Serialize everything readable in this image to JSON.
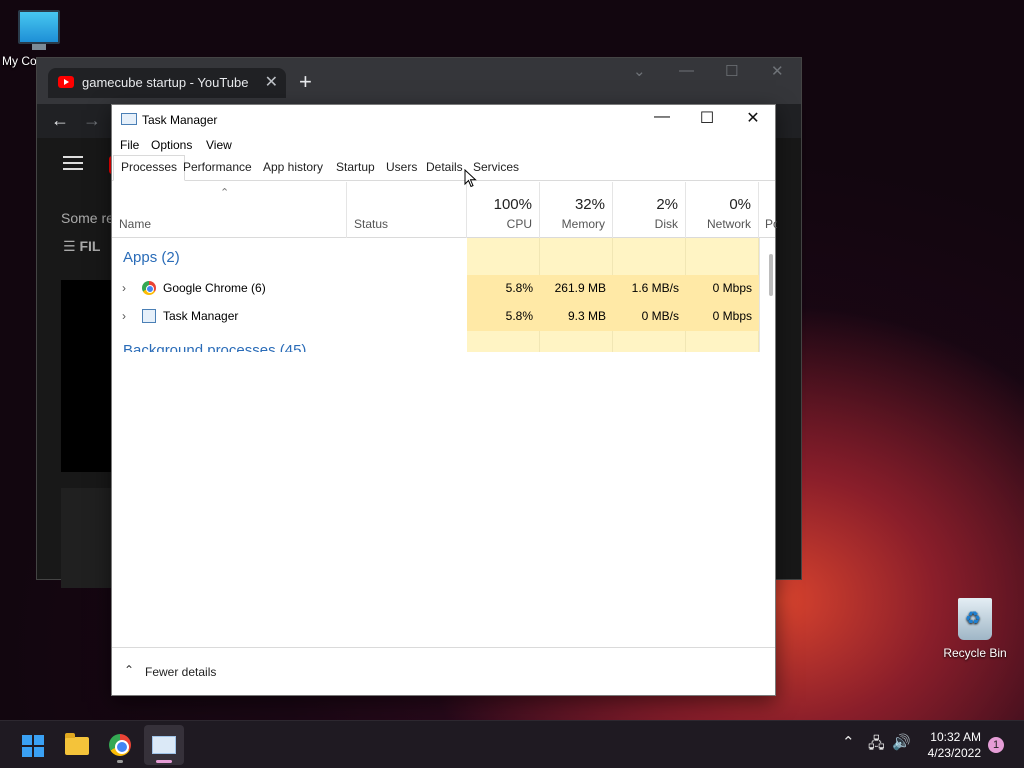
{
  "desktop": {
    "icons": [
      {
        "label": "My Co",
        "icon": "monitor-icon"
      },
      {
        "label": "Recycle Bin",
        "icon": "recycle-bin-icon"
      }
    ]
  },
  "chrome": {
    "tab_title": "gamecube startup - YouTube",
    "tab_close": "✕",
    "new_tab": "+",
    "back": "←",
    "forward": "→",
    "page_text_some": "Some re",
    "page_text_filters": "FIL",
    "win_controls": {
      "minimize": "—",
      "maximize": "☐",
      "close": "✕",
      "dropdown": "⌄"
    }
  },
  "task_manager": {
    "title": "Task Manager",
    "controls": {
      "minimize": "—",
      "maximize": "☐",
      "close": "✕"
    },
    "menu": [
      "File",
      "Options",
      "View"
    ],
    "tabs": [
      "Processes",
      "Performance",
      "App history",
      "Startup",
      "Users",
      "Details",
      "Services"
    ],
    "active_tab": "Processes",
    "columns": {
      "name": "Name",
      "status": "Status",
      "cpu": {
        "pct": "100%",
        "label": "CPU"
      },
      "memory": {
        "pct": "32%",
        "label": "Memory"
      },
      "disk": {
        "pct": "2%",
        "label": "Disk"
      },
      "network": {
        "pct": "0%",
        "label": "Network"
      },
      "power": "Po"
    },
    "sort_caret": "⌃",
    "groups": {
      "apps": "Apps (2)",
      "background": "Background processes (45)"
    },
    "rows": [
      {
        "name": "Google Chrome (6)",
        "cpu": "5.8%",
        "memory": "261.9 MB",
        "disk": "1.6 MB/s",
        "network": "0 Mbps",
        "icon": "chrome-icon"
      },
      {
        "name": "Task Manager",
        "cpu": "5.8%",
        "memory": "9.3 MB",
        "disk": "0 MB/s",
        "network": "0 Mbps",
        "icon": "task-manager-icon"
      }
    ],
    "expand_glyph": "›",
    "footer": {
      "caret": "⌃",
      "label": "Fewer details"
    }
  },
  "taskbar": {
    "tray_chevron": "⌃",
    "clock_time": "10:32 AM",
    "clock_date": "4/23/2022",
    "notification_count": "1"
  }
}
